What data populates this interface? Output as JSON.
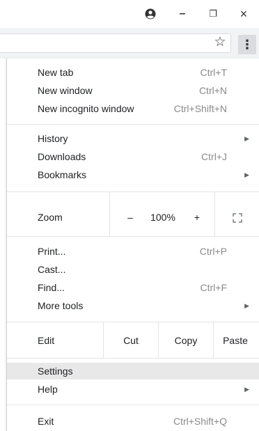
{
  "window_controls": {
    "account_icon": "account-circle-icon",
    "minimize_glyph": "–",
    "restore_glyph": "❐",
    "close_glyph": "×"
  },
  "toolbar": {
    "bookmark_star_glyph": "☆",
    "menu_glyph": "⋮"
  },
  "menu": {
    "new_tab": {
      "label": "New tab",
      "shortcut": "Ctrl+T"
    },
    "new_window": {
      "label": "New window",
      "shortcut": "Ctrl+N"
    },
    "new_incognito": {
      "label": "New incognito window",
      "shortcut": "Ctrl+Shift+N"
    },
    "history": {
      "label": "History",
      "arrow": "▶"
    },
    "downloads": {
      "label": "Downloads",
      "shortcut": "Ctrl+J"
    },
    "bookmarks": {
      "label": "Bookmarks",
      "arrow": "▶"
    },
    "zoom": {
      "label": "Zoom",
      "minus": "–",
      "value": "100%",
      "plus": "+"
    },
    "print": {
      "label": "Print...",
      "shortcut": "Ctrl+P"
    },
    "cast": {
      "label": "Cast..."
    },
    "find": {
      "label": "Find...",
      "shortcut": "Ctrl+F"
    },
    "more_tools": {
      "label": "More tools",
      "arrow": "▶"
    },
    "edit": {
      "label": "Edit",
      "cut": "Cut",
      "copy": "Copy",
      "paste": "Paste"
    },
    "settings": {
      "label": "Settings",
      "highlighted": true
    },
    "help": {
      "label": "Help",
      "arrow": "▶"
    },
    "exit": {
      "label": "Exit",
      "shortcut": "Ctrl+Shift+Q"
    }
  },
  "colors": {
    "highlight": "#e8e8e8",
    "shortcut_text": "#8a8a8a",
    "toolbar_bg": "#f1f3f4"
  }
}
